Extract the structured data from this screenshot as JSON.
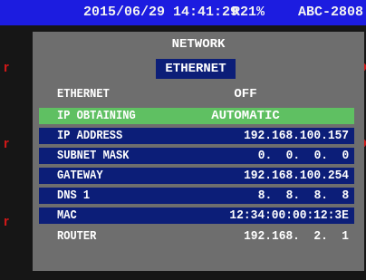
{
  "status_bar": {
    "datetime": "2015/06/29 14:41:29",
    "recording": "R21%",
    "camera_id": "ABC-2808"
  },
  "side_marks": {
    "left": "r",
    "right": "D"
  },
  "menu": {
    "title": "NETWORK",
    "active_tab": "ETHERNET",
    "rows": [
      {
        "label": "ETHERNET",
        "value": "OFF"
      },
      {
        "label": "IP OBTAINING",
        "value": "AUTOMATIC"
      },
      {
        "label": "IP ADDRESS",
        "value": "192.168.100.157"
      },
      {
        "label": "SUBNET MASK",
        "value": "0.  0.  0.  0"
      },
      {
        "label": "GATEWAY",
        "value": "192.168.100.254"
      },
      {
        "label": "DNS 1",
        "value": "8.  8.  8.  8"
      },
      {
        "label": "MAC",
        "value": "12:34:00:00:12:3E"
      },
      {
        "label": "ROUTER",
        "value": "192.168.  2.  1"
      }
    ]
  },
  "colors": {
    "status_bar": "#1c1ce0",
    "panel": "#6e6e6e",
    "row_highlight": "#0c1e78",
    "row_selected": "#5fc062",
    "side_mark": "#d01818"
  }
}
